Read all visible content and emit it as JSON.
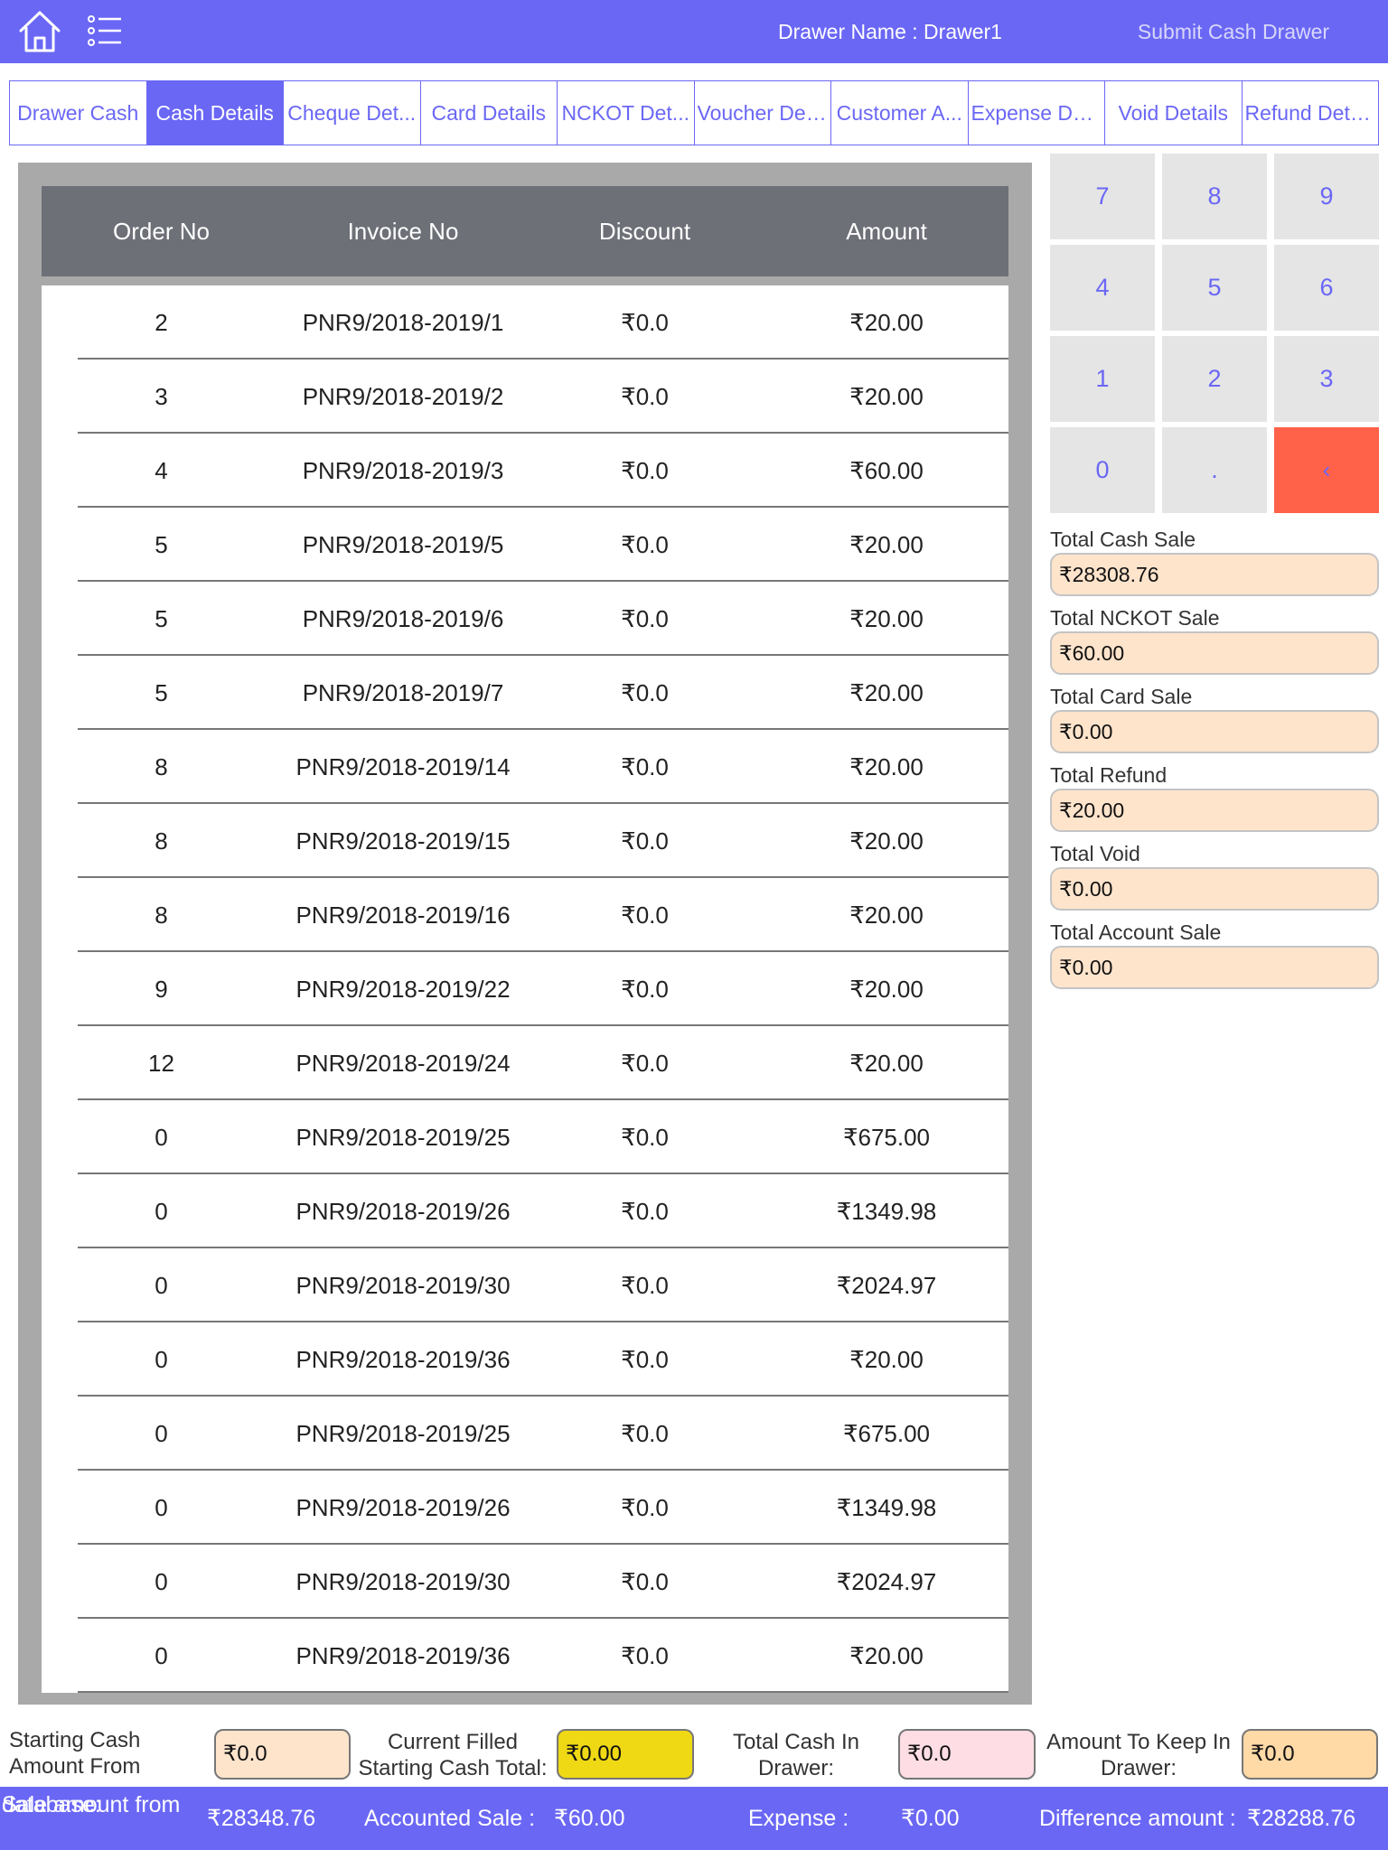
{
  "header": {
    "drawer_name": "Drawer Name : Drawer1",
    "submit_label": "Submit Cash Drawer"
  },
  "tabs": [
    {
      "label": "Drawer Cash",
      "active": false
    },
    {
      "label": "Cash Details",
      "active": true
    },
    {
      "label": "Cheque Det...",
      "active": false
    },
    {
      "label": "Card Details",
      "active": false
    },
    {
      "label": "NCKOT Det...",
      "active": false
    },
    {
      "label": "Voucher Det...",
      "active": false
    },
    {
      "label": "Customer A...",
      "active": false
    },
    {
      "label": "Expense Det...",
      "active": false
    },
    {
      "label": "Void Details",
      "active": false
    },
    {
      "label": "Refund Deta...",
      "active": false
    }
  ],
  "table": {
    "columns": [
      "Order No",
      "Invoice No",
      "Discount",
      "Amount"
    ],
    "rows": [
      [
        "2",
        "PNR9/2018-2019/1",
        "₹0.0",
        "₹20.00"
      ],
      [
        "3",
        "PNR9/2018-2019/2",
        "₹0.0",
        "₹20.00"
      ],
      [
        "4",
        "PNR9/2018-2019/3",
        "₹0.0",
        "₹60.00"
      ],
      [
        "5",
        "PNR9/2018-2019/5",
        "₹0.0",
        "₹20.00"
      ],
      [
        "5",
        "PNR9/2018-2019/6",
        "₹0.0",
        "₹20.00"
      ],
      [
        "5",
        "PNR9/2018-2019/7",
        "₹0.0",
        "₹20.00"
      ],
      [
        "8",
        "PNR9/2018-2019/14",
        "₹0.0",
        "₹20.00"
      ],
      [
        "8",
        "PNR9/2018-2019/15",
        "₹0.0",
        "₹20.00"
      ],
      [
        "8",
        "PNR9/2018-2019/16",
        "₹0.0",
        "₹20.00"
      ],
      [
        "9",
        "PNR9/2018-2019/22",
        "₹0.0",
        "₹20.00"
      ],
      [
        "12",
        "PNR9/2018-2019/24",
        "₹0.0",
        "₹20.00"
      ],
      [
        "0",
        "PNR9/2018-2019/25",
        "₹0.0",
        "₹675.00"
      ],
      [
        "0",
        "PNR9/2018-2019/26",
        "₹0.0",
        "₹1349.98"
      ],
      [
        "0",
        "PNR9/2018-2019/30",
        "₹0.0",
        "₹2024.97"
      ],
      [
        "0",
        "PNR9/2018-2019/36",
        "₹0.0",
        "₹20.00"
      ],
      [
        "0",
        "PNR9/2018-2019/25",
        "₹0.0",
        "₹675.00"
      ],
      [
        "0",
        "PNR9/2018-2019/26",
        "₹0.0",
        "₹1349.98"
      ],
      [
        "0",
        "PNR9/2018-2019/30",
        "₹0.0",
        "₹2024.97"
      ],
      [
        "0",
        "PNR9/2018-2019/36",
        "₹0.0",
        "₹20.00"
      ]
    ]
  },
  "keypad": {
    "keys": [
      "7",
      "8",
      "9",
      "4",
      "5",
      "6",
      "1",
      "2",
      "3",
      "0",
      ".",
      "‹"
    ]
  },
  "totals": [
    {
      "label": "Total Cash Sale",
      "value": "₹28308.76"
    },
    {
      "label": "Total NCKOT Sale",
      "value": "₹60.00"
    },
    {
      "label": "Total Card Sale",
      "value": "₹0.00"
    },
    {
      "label": "Total Refund",
      "value": "₹20.00"
    },
    {
      "label": "Total Void",
      "value": "₹0.00"
    },
    {
      "label": "Total Account Sale",
      "value": "₹0.00"
    }
  ],
  "bottom": {
    "starting_cash_label_1": "Starting Cash",
    "starting_cash_label_2": "Amount From",
    "starting_cash_value": "₹0.0",
    "current_filled_label_1": "Current Filled",
    "current_filled_label_2": "Starting Cash Total:",
    "current_filled_value": "₹0.00",
    "total_cash_label_1": "Total Cash In",
    "total_cash_label_2": "Drawer:",
    "total_cash_value": "₹0.0",
    "keep_label_1": "Amount To Keep In",
    "keep_label_2": "Drawer:",
    "keep_value": "₹0.0"
  },
  "footer": {
    "sale_db_label_1": "Sale amount from",
    "sale_db_label_2": "database:",
    "sale_db_value": "₹28348.76",
    "accounted_label": "Accounted Sale :",
    "accounted_value": "₹60.00",
    "expense_label": "Expense :",
    "expense_value": "₹0.00",
    "difference_label": "Difference amount :",
    "difference_value": "₹28288.76"
  },
  "colors": {
    "brand": "#6a67f5",
    "total_box": "#ffe4cc",
    "current_filled_box": "#efd814",
    "cash_in_drawer_box": "#ffdde4",
    "keep_box": "#ffd9a6",
    "backspace_key": "#ff6249"
  },
  "icons": {
    "home": "home-icon",
    "menu": "list-menu-icon"
  }
}
